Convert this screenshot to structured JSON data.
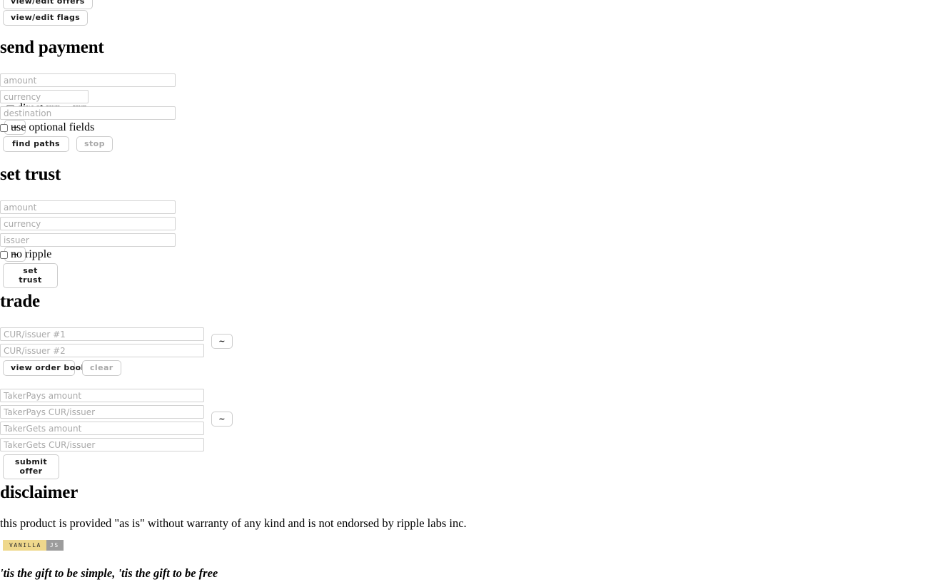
{
  "top_buttons": [
    {
      "label": "view/edit offers",
      "name": "view-edit-offers-button"
    },
    {
      "label": "view/edit flags",
      "name": "view-edit-flags-button"
    }
  ],
  "send_payment": {
    "title": "send payment",
    "amount_placeholder": "amount",
    "currency_placeholder": "currency",
    "destination_placeholder": "destination",
    "tilde_label": "~",
    "direct_xrp_label": "direct xrp→xrp",
    "optional_fields_label": "use optional fields",
    "find_paths_label": "find paths",
    "stop_label": "stop"
  },
  "set_trust": {
    "title": "set trust",
    "amount_placeholder": "amount",
    "currency_placeholder": "currency",
    "issuer_placeholder": "issuer",
    "tilde_label": "~",
    "no_ripple_label": "no ripple",
    "set_trust_label": "set trust"
  },
  "trade": {
    "title": "trade",
    "cur_issuer_1_placeholder": "CUR/issuer #1",
    "cur_issuer_2_placeholder": "CUR/issuer #2",
    "tilde_label_book": "~",
    "view_order_book_label": "view order book",
    "clear_label": "clear",
    "takerpays_amount_placeholder": "TakerPays amount",
    "takerpays_cur_placeholder": "TakerPays CUR/issuer",
    "takergets_amount_placeholder": "TakerGets amount",
    "takergets_cur_placeholder": "TakerGets CUR/issuer",
    "tilde_label_offer": "~",
    "submit_offer_label": "submit offer"
  },
  "disclaimer": {
    "title": "disclaimer",
    "text": "this product is provided \"as is\" without warranty of any kind and is not endorsed by ripple labs inc."
  },
  "badge": {
    "left_text": "VANILLA",
    "right_text": "JS",
    "left_color": "#efd88c",
    "right_color": "#9c9c9c"
  },
  "motto": "'tis the gift to be simple, 'tis the gift to be free"
}
